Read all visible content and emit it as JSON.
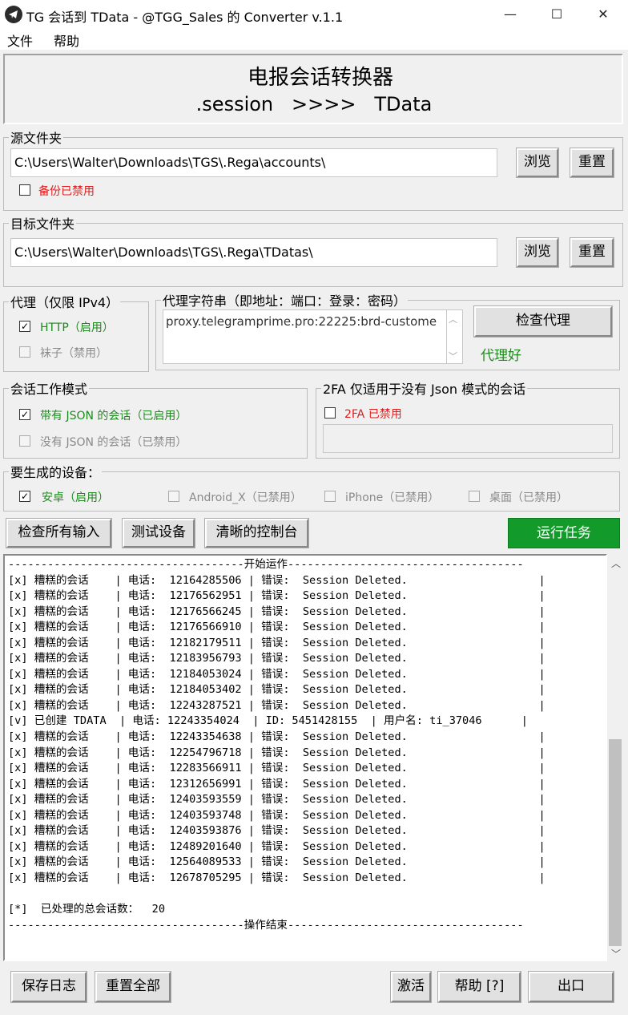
{
  "window": {
    "title": "TG 会话到 TData - @TGG_Sales 的 Converter v.1.1",
    "minimize": "—",
    "maximize": "☐",
    "close": "✕"
  },
  "menu": {
    "file": "文件",
    "help": "帮助"
  },
  "banner": {
    "title": "电报会话转换器",
    "subtitle": ".session   >>>>   TData"
  },
  "source": {
    "legend": "源文件夹",
    "path": "C:\\Users\\Walter\\Downloads\\TGS\\.Rega\\accounts\\",
    "browse": "浏览",
    "reset": "重置",
    "backup_label": "备份已禁用"
  },
  "target": {
    "legend": "目标文件夹",
    "path": "C:\\Users\\Walter\\Downloads\\TGS\\.Rega\\TDatas\\",
    "browse": "浏览",
    "reset": "重置"
  },
  "proxy": {
    "legend": "代理（仅限 IPv4）",
    "http_label": "HTTP（启用）",
    "socks_label": "袜子（禁用）",
    "string_legend": "代理字符串（即地址：端口：登录：密码）",
    "string_value": "proxy.telegramprime.pro:22225:brd-custome",
    "check_button": "检查代理",
    "status": "代理好"
  },
  "session_mode": {
    "legend": "会话工作模式",
    "with_json": "带有 JSON 的会话（已启用）",
    "without_json": "没有 JSON 的会话（已禁用）"
  },
  "twofa": {
    "legend": "2FA 仅适用于没有 Json 模式的会话",
    "label": "2FA 已禁用",
    "value": ""
  },
  "devices": {
    "legend": "要生成的设备：",
    "android": "安卓（启用）",
    "android_x": "Android_X（已禁用）",
    "iphone": "iPhone（已禁用）",
    "desktop": "桌面（已禁用）"
  },
  "actions": {
    "check_inputs": "检查所有输入",
    "test_device": "测试设备",
    "clear_console": "清晰的控制台",
    "run_task": "运行任务"
  },
  "console": {
    "lines": [
      "------------------------------------开始运作------------------------------------",
      "[x] 糟糕的会话    | 电话:  12164285506 | 错误:  Session Deleted.                    |",
      "[x] 糟糕的会话    | 电话:  12176562951 | 错误:  Session Deleted.                    |",
      "[x] 糟糕的会话    | 电话:  12176566245 | 错误:  Session Deleted.                    |",
      "[x] 糟糕的会话    | 电话:  12176566910 | 错误:  Session Deleted.                    |",
      "[x] 糟糕的会话    | 电话:  12182179511 | 错误:  Session Deleted.                    |",
      "[x] 糟糕的会话    | 电话:  12183956793 | 错误:  Session Deleted.                    |",
      "[x] 糟糕的会话    | 电话:  12184053024 | 错误:  Session Deleted.                    |",
      "[x] 糟糕的会话    | 电话:  12184053402 | 错误:  Session Deleted.                    |",
      "[x] 糟糕的会话    | 电话:  12243287521 | 错误:  Session Deleted.                    |",
      "[v] 已创建 TDATA  | 电话: 12243354024  | ID: 5451428155  | 用户名: ti_37046      |",
      "[x] 糟糕的会话    | 电话:  12243354638 | 错误:  Session Deleted.                    |",
      "[x] 糟糕的会话    | 电话:  12254796718 | 错误:  Session Deleted.                    |",
      "[x] 糟糕的会话    | 电话:  12283566911 | 错误:  Session Deleted.                    |",
      "[x] 糟糕的会话    | 电话:  12312656991 | 错误:  Session Deleted.                    |",
      "[x] 糟糕的会话    | 电话:  12403593559 | 错误:  Session Deleted.                    |",
      "[x] 糟糕的会话    | 电话:  12403593748 | 错误:  Session Deleted.                    |",
      "[x] 糟糕的会话    | 电话:  12403593876 | 错误:  Session Deleted.                    |",
      "[x] 糟糕的会话    | 电话:  12489201640 | 错误:  Session Deleted.                    |",
      "[x] 糟糕的会话    | 电话:  12564089533 | 错误:  Session Deleted.                    |",
      "[x] 糟糕的会话    | 电话:  12678705295 | 错误:  Session Deleted.                    |",
      "",
      "[*]  已处理的总会话数：  20",
      "------------------------------------操作结束------------------------------------"
    ]
  },
  "footer": {
    "save_log": "保存日志",
    "reset_all": "重置全部",
    "activate": "激活",
    "help": "帮助 [?]",
    "exit": "出口"
  },
  "colors": {
    "run_button": "#129b2a",
    "disabled_text": "#e21c1c",
    "enabled_text": "#1e8a1e"
  }
}
